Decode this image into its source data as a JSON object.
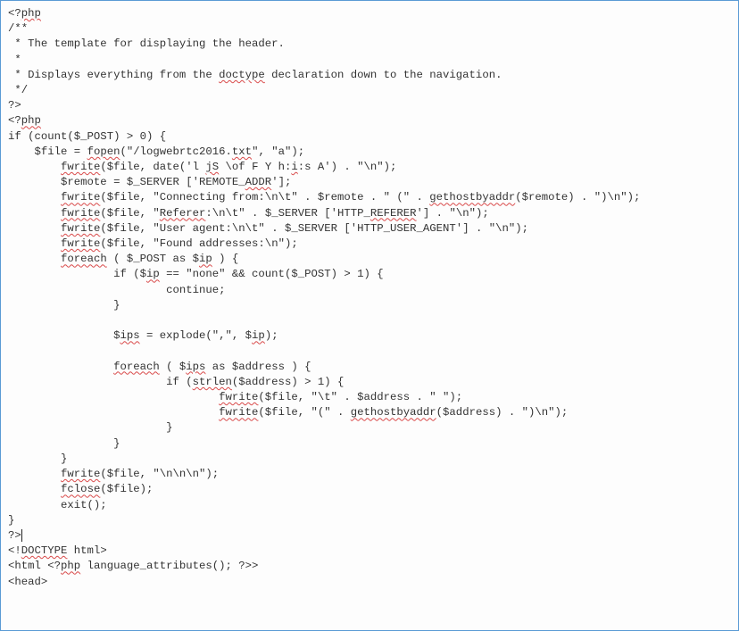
{
  "code": {
    "l1a": "<?",
    "l1b": "php",
    "l2": "/**",
    "l3": " * The template for displaying the header.",
    "l4": " *",
    "l5a": " * Displays everything from the ",
    "l5b": "doctype",
    "l5c": " declaration down to the navigation.",
    "l6": " */",
    "l7": "?>",
    "l8a": "<?",
    "l8b": "php",
    "l9": "if (count($_POST) > 0) {",
    "l10a": "    $file = ",
    "l10b": "fopen",
    "l10c": "(\"/logwebrtc2016.",
    "l10d": "txt",
    "l10e": "\", \"a\");",
    "l11a": "        ",
    "l11b": "fwrite",
    "l11c": "($file, date('l ",
    "l11d": "jS",
    "l11e": " \\of F Y h:",
    "l11f": "i",
    "l11g": ":s A') . \"\\n\");",
    "l12a": "        $remote = $_SERVER ['REMOTE_",
    "l12b": "ADDR",
    "l12c": "'];",
    "l13a": "        ",
    "l13b": "fwrite",
    "l13c": "($file, \"Connecting from:\\n\\t\" . $remote . \" (\" . ",
    "l13d": "gethostbyaddr",
    "l13e": "($remote) . \")\\n\");",
    "l14a": "        ",
    "l14b": "fwrite",
    "l14c": "($file, \"",
    "l14d": "Referer",
    "l14e": ":\\n\\t\" . $_SERVER ['HTTP_",
    "l14f": "REFERER",
    "l14g": "'] . \"\\n\");",
    "l15a": "        ",
    "l15b": "fwrite",
    "l15c": "($file, \"User agent:\\n\\t\" . $_SERVER ['HTTP_USER_AGENT'] . \"\\n\");",
    "l16a": "        ",
    "l16b": "fwrite",
    "l16c": "($file, \"Found addresses:\\n\");",
    "l17a": "        ",
    "l17b": "foreach",
    "l17c": " ( $_POST as $",
    "l17d": "ip",
    "l17e": " ) {",
    "l18a": "                if ($",
    "l18b": "ip",
    "l18c": " == \"none\" && count($_POST) > 1) {",
    "l19": "                        continue;",
    "l20": "                }",
    "l21": "",
    "l22a": "                $",
    "l22b": "ips",
    "l22c": " = explode(\",\", $",
    "l22d": "ip",
    "l22e": ");",
    "l23": "",
    "l24a": "                ",
    "l24b": "foreach",
    "l24c": " ( $",
    "l24d": "ips",
    "l24e": " as $address ) {",
    "l25a": "                        if (",
    "l25b": "strlen",
    "l25c": "($address) > 1) {",
    "l26a": "                                ",
    "l26b": "fwrite",
    "l26c": "($file, \"\\t\" . $address . \" \");",
    "l27a": "                                ",
    "l27b": "fwrite",
    "l27c": "($file, \"(\" . ",
    "l27d": "gethostbyaddr",
    "l27e": "($address) . \")\\n\");",
    "l28": "                        }",
    "l29": "                }",
    "l30": "        }",
    "l31a": "        ",
    "l31b": "fwrite",
    "l31c": "($file, \"\\n\\n\\n\");",
    "l32a": "        ",
    "l32b": "fclose",
    "l32c": "($file);",
    "l33": "        exit();",
    "l34": "}",
    "l35": "?>",
    "l36a": "<!",
    "l36b": "DOCTYPE",
    "l36c": " html>",
    "l37a": "<html <?",
    "l37b": "php",
    "l37c": " language_attributes(); ?>>",
    "l38": "<head>"
  }
}
